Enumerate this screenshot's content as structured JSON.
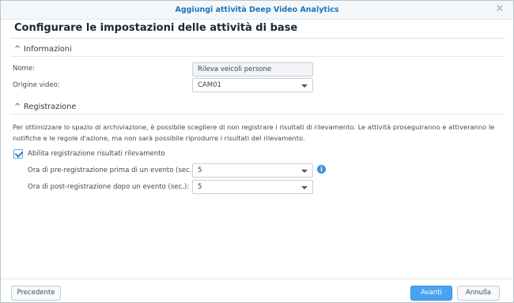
{
  "window": {
    "title": "Aggiungi attività Deep Video Analytics",
    "heading": "Configurare le impostazioni delle attività di base"
  },
  "informazioni": {
    "section_label": "Informazioni",
    "name_label": "Nome:",
    "name_value": "Rileva veicoli persone",
    "source_label": "Origine video:",
    "source_value": "CAM01"
  },
  "registrazione": {
    "section_label": "Registrazione",
    "description": "Per ottimizzare lo spazio di archiviazione, è possibile scegliere di non registrare i risultati di rilevamento. Le attività proseguiranno e attiveranno le notifiche e le regole d'azione, ma non sarà possibile riprodurre i risultati del rilevamento.",
    "enable_label": "Abilita registrazione risultati rilevamento",
    "enable_checked": true,
    "pre_label": "Ora di pre-registrazione prima di un evento (sec.):",
    "pre_value": "5",
    "post_label": "Ora di post-registrazione dopo un evento (sec.):",
    "post_value": "5"
  },
  "footer": {
    "back_label": "Precedente",
    "next_label": "Avanti",
    "cancel_label": "Annulla"
  },
  "colors": {
    "accent": "#4aa3ef",
    "title": "#1f75b8"
  }
}
